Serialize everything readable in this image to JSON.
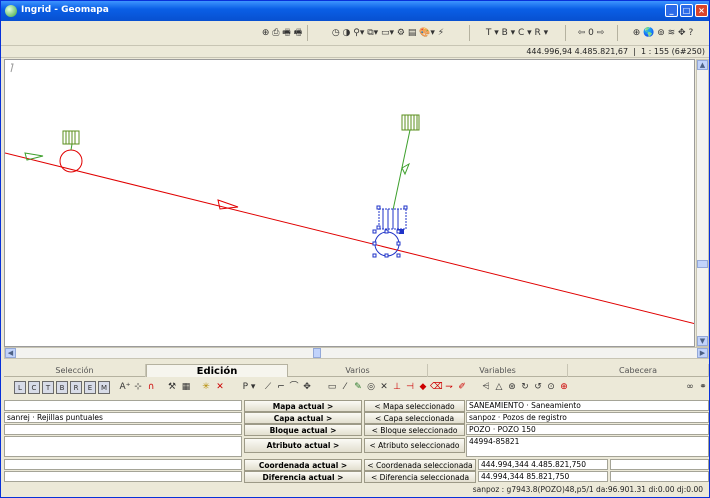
{
  "window": {
    "title": "Ingrid - Geomapa"
  },
  "toolbar": {
    "groups": [
      "⊕ ⎙ 🖷 🖷",
      "◷ ◑ ⚲▾ ⧉▾ ▭▾ ⚙ ▤ 🎨▾ ⚡",
      "T ▾  B ▾  C ▾  R ▾",
      "⇦ 0 ⇨",
      "⊕ 🌎 ⊚ ≋ ✥ ?"
    ],
    "zoom_value": "0"
  },
  "coordbar": {
    "coordinates": "444.996,94  4.485.821,67",
    "scale": "1 : 155 (6#250)"
  },
  "tabs": [
    "Selección",
    "Edición",
    "Varios",
    "Variables",
    "Cabecera"
  ],
  "icons": {
    "left": [
      "L",
      "C",
      "T",
      "B",
      "R",
      "E",
      "M"
    ],
    "p_label": "P ▾"
  },
  "form": {
    "rows": [
      {
        "left": "",
        "button": "Mapa actual >",
        "mid": "< Mapa seleccionado",
        "right": "SANEAMIENTO · Saneamiento"
      },
      {
        "left": "sanrej · Rejillas puntuales",
        "button": "Capa actual >",
        "mid": "< Capa seleccionada",
        "right": "sanpoz · Pozos de registro"
      },
      {
        "left": "",
        "button": "Bloque actual >",
        "mid": "< Bloque seleccionado",
        "right": "POZO · POZO 150"
      },
      {
        "left": "",
        "button": "Atributo actual >",
        "mid": "< Atributo seleccionado",
        "right": "44994-85821"
      },
      {
        "left": "",
        "button": "Coordenada actual >",
        "mid": "< Coordenada seleccionada",
        "right": "444.994,344  4.485.821,750"
      },
      {
        "left": "",
        "button": "Diferencia actual >",
        "mid": "< Diferencia seleccionada",
        "right": "44.994,344  85.821,750"
      }
    ]
  },
  "status": {
    "text": "sanpoz : g7943.8(POZO)48,p5/1  da:96.901.31  di:0.00  dj:0.00"
  },
  "colors": {
    "line": "#e00000",
    "connector": "#3da02c",
    "symbol": "#5b8f1c",
    "selection": "#1f33c8"
  }
}
